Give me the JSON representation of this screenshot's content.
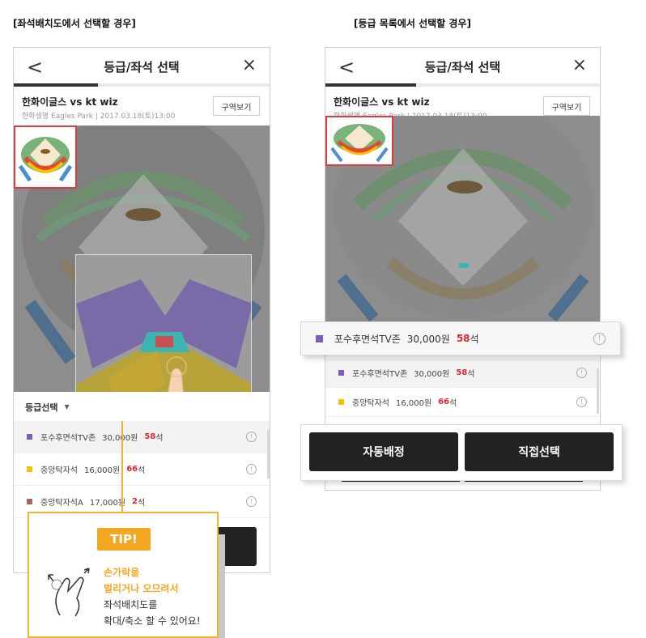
{
  "left_caption": "[좌석배치도에서 선택할 경우]",
  "right_caption": "[등급 목록에서 선택할 경우]",
  "screen": {
    "back_glyph": "<",
    "close_glyph": "×",
    "title": "등급/좌석 선택",
    "teams": "한화이글스 vs kt wiz",
    "venue": "한화생명 Eagles Park | 2017.03.18(토)13:00",
    "zone_button": "구역보기"
  },
  "grade_header": {
    "label": "등급선택"
  },
  "grades": [
    {
      "name": "포수후면석TV존",
      "price": "30,000원",
      "count": "58",
      "unit": "석",
      "color": "#7b5cc2"
    },
    {
      "name": "중앙탁자석",
      "price": "16,000원",
      "count": "66",
      "unit": "석",
      "color": "#f2c400"
    },
    {
      "name": "중앙탁자석A",
      "price": "17,000원",
      "count": "2",
      "unit": "석",
      "color": "#a8645a"
    }
  ],
  "info_glyph": "!",
  "buttons": {
    "auto": "자동배정",
    "direct": "직접선택"
  },
  "tip": {
    "badge": "TIP!",
    "line1": "손가락을",
    "line2": "벌리거나 오므려서",
    "line3": "좌석배치도를",
    "line4": "확대/축소 할 수 있어요!"
  }
}
